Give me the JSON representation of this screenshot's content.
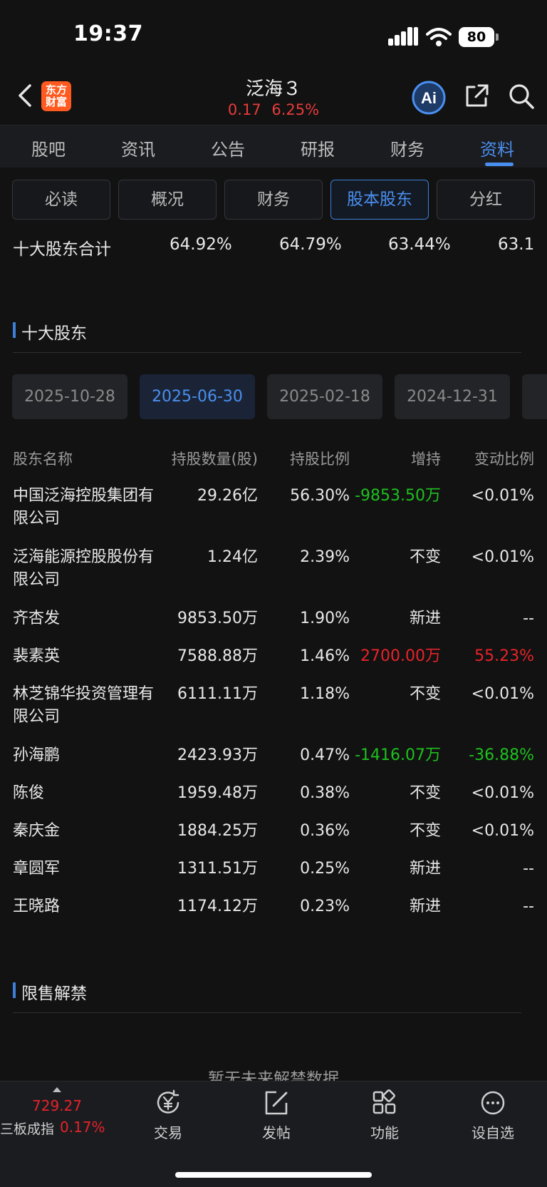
{
  "status": {
    "time": "19:37",
    "battery": "80"
  },
  "header": {
    "logo_line1": "东方",
    "logo_line2": "财富",
    "title": "泛海３",
    "change_value": "0.17",
    "change_pct": "6.25%",
    "ai_label": "Ai"
  },
  "main_tabs": [
    {
      "label": "股吧"
    },
    {
      "label": "资讯"
    },
    {
      "label": "公告"
    },
    {
      "label": "研报"
    },
    {
      "label": "财务"
    },
    {
      "label": "资料",
      "active": true
    }
  ],
  "sub_tabs": [
    {
      "label": "必读"
    },
    {
      "label": "概况"
    },
    {
      "label": "财务"
    },
    {
      "label": "股本股东",
      "active": true
    },
    {
      "label": "分红"
    }
  ],
  "summary": {
    "label": "十大股东合计",
    "values": [
      "64.92%",
      "64.79%",
      "63.44%",
      "63.1"
    ]
  },
  "top10": {
    "title": "十大股东",
    "dates": [
      "2025-10-28",
      "2025-06-30",
      "2025-02-18",
      "2024-12-31"
    ],
    "active_date_index": 1,
    "columns": {
      "name": "股东名称",
      "shares": "持股数量(股)",
      "ratio": "持股比例",
      "change": "增持",
      "change_pct": "变动比例"
    },
    "rows": [
      {
        "name": "中国泛海控股集团有限公司",
        "shares": "29.26亿",
        "ratio": "56.30%",
        "change": "-9853.50万",
        "change_dir": "down",
        "change_pct": "<0.01%",
        "pct_dir": ""
      },
      {
        "name": "泛海能源控股股份有限公司",
        "shares": "1.24亿",
        "ratio": "2.39%",
        "change": "不变",
        "change_dir": "",
        "change_pct": "<0.01%",
        "pct_dir": ""
      },
      {
        "name": "齐杏发",
        "shares": "9853.50万",
        "ratio": "1.90%",
        "change": "新进",
        "change_dir": "",
        "change_pct": "--",
        "pct_dir": ""
      },
      {
        "name": "裴素英",
        "shares": "7588.88万",
        "ratio": "1.46%",
        "change": "2700.00万",
        "change_dir": "up",
        "change_pct": "55.23%",
        "pct_dir": "up"
      },
      {
        "name": "林芝锦华投资管理有限公司",
        "shares": "6111.11万",
        "ratio": "1.18%",
        "change": "不变",
        "change_dir": "",
        "change_pct": "<0.01%",
        "pct_dir": ""
      },
      {
        "name": "孙海鹏",
        "shares": "2423.93万",
        "ratio": "0.47%",
        "change": "-1416.07万",
        "change_dir": "down",
        "change_pct": "-36.88%",
        "pct_dir": "down"
      },
      {
        "name": "陈俊",
        "shares": "1959.48万",
        "ratio": "0.38%",
        "change": "不变",
        "change_dir": "",
        "change_pct": "<0.01%",
        "pct_dir": ""
      },
      {
        "name": "秦庆金",
        "shares": "1884.25万",
        "ratio": "0.36%",
        "change": "不变",
        "change_dir": "",
        "change_pct": "<0.01%",
        "pct_dir": ""
      },
      {
        "name": "章圆军",
        "shares": "1311.51万",
        "ratio": "0.25%",
        "change": "新进",
        "change_dir": "",
        "change_pct": "--",
        "pct_dir": ""
      },
      {
        "name": "王晓路",
        "shares": "1174.12万",
        "ratio": "0.23%",
        "change": "新进",
        "change_dir": "",
        "change_pct": "--",
        "pct_dir": ""
      }
    ]
  },
  "restricted": {
    "title": "限售解禁",
    "empty_text": "暂无未来解禁数据"
  },
  "bottom_bar": {
    "index_value": "729.27",
    "index_label": "三板成指",
    "index_pct": "0.17%",
    "nav": [
      {
        "label": "交易",
        "icon": "yen-cycle-icon"
      },
      {
        "label": "发帖",
        "icon": "edit-icon"
      },
      {
        "label": "功能",
        "icon": "grid-icon"
      },
      {
        "label": "设自选",
        "icon": "more-circle-icon"
      }
    ]
  },
  "colors": {
    "accent": "#4a8ff0",
    "up": "#e6232a",
    "down": "#1ec01e",
    "brand": "#ff5a1f"
  }
}
